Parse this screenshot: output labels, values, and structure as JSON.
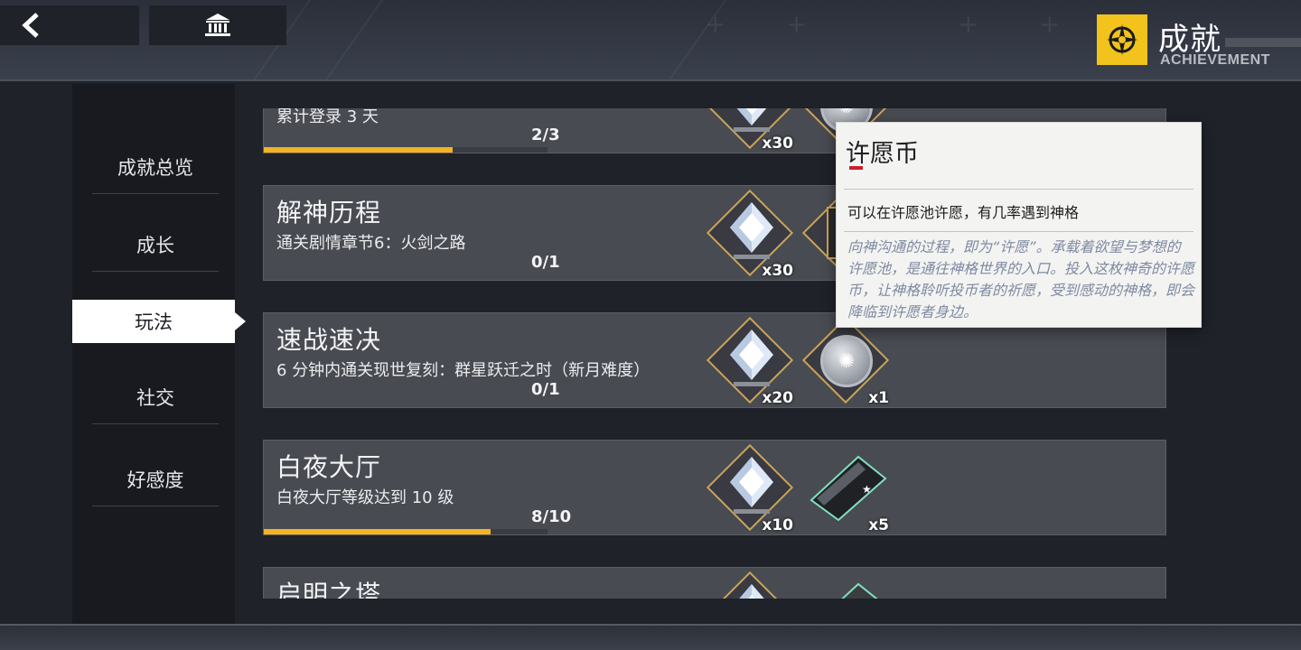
{
  "header": {
    "title": "成就",
    "subtitle": "ACHIEVEMENT",
    "back_icon": "chevron-left-icon",
    "home_icon": "museum-icon",
    "emblem_icon": "compass-badge-icon"
  },
  "sidebar": {
    "items": [
      {
        "label": "成就总览",
        "active": false
      },
      {
        "label": "成长",
        "active": false
      },
      {
        "label": "玩法",
        "active": true
      },
      {
        "label": "社交",
        "active": false
      },
      {
        "label": "好感度",
        "active": false
      }
    ]
  },
  "achievements": [
    {
      "title": "",
      "description": "累计登录 3 天",
      "progress": "2/3",
      "progress_fraction": 0.667,
      "rewards": [
        {
          "icon": "crystal-icon",
          "qty": "x30"
        },
        {
          "icon": "wish-coin-icon",
          "qty": ""
        }
      ]
    },
    {
      "title": "解神历程",
      "description": "通关剧情章节6：火剑之路",
      "progress": "0/1",
      "progress_fraction": 0,
      "rewards": [
        {
          "icon": "crystal-icon",
          "qty": "x30"
        },
        {
          "icon": "card-icon",
          "qty": ""
        }
      ]
    },
    {
      "title": "速战速决",
      "description": "6 分钟内通关现世复刻：群星跃迁之时（新月难度）",
      "progress": "0/1",
      "progress_fraction": 0,
      "rewards": [
        {
          "icon": "crystal-icon",
          "qty": "x20"
        },
        {
          "icon": "wish-coin-icon",
          "qty": "x1"
        }
      ]
    },
    {
      "title": "白夜大厅",
      "description": "白夜大厅等级达到 10 级",
      "progress": "8/10",
      "progress_fraction": 0.8,
      "rewards": [
        {
          "icon": "crystal-icon",
          "qty": "x10"
        },
        {
          "icon": "ticket-icon",
          "qty": "x5"
        }
      ]
    },
    {
      "title": "启明之塔",
      "description": "",
      "progress": "",
      "progress_fraction": 0,
      "rewards": [
        {
          "icon": "crystal-icon",
          "qty": ""
        },
        {
          "icon": "ticket-icon",
          "qty": ""
        }
      ]
    }
  ],
  "tooltip": {
    "title": "许愿币",
    "description": "可以在许愿池许愿，有几率遇到神格",
    "lore": "向神沟通的过程，即为“许愿”。承载着欲望与梦想的许愿池，是通往神格世界的入口。投入这枚神奇的许愿币，让神格聆听投币者的祈愿，受到感动的神格，即会降临到许愿者身边。"
  },
  "colors": {
    "accent": "#f3b322",
    "emblem": "#f2c21d",
    "tooltip_mark": "#c8202a",
    "card_bg": "#494b52"
  }
}
